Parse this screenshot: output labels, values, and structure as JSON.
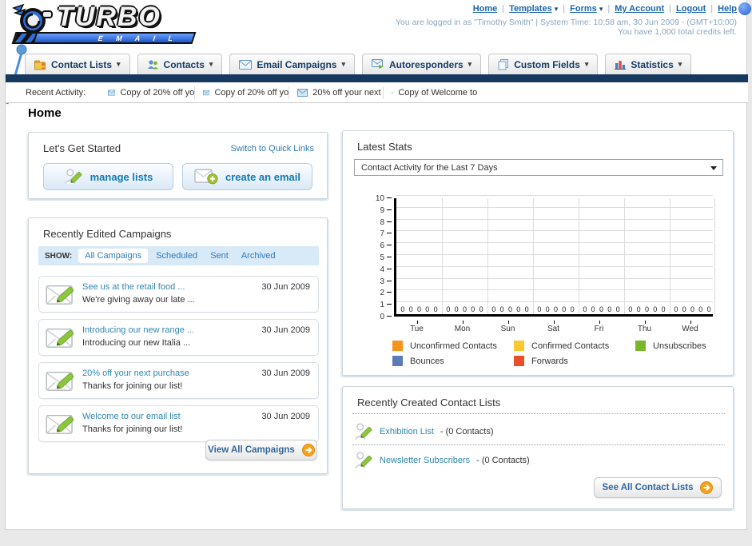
{
  "icons": {
    "dropdown_arrow": "▾"
  },
  "header": {
    "logo_title": "TURBO",
    "logo_subtitle": "E M A I L",
    "separator": "|",
    "nav_links": [
      {
        "label": "Home",
        "dropdown": false
      },
      {
        "label": "Templates",
        "dropdown": true
      },
      {
        "label": "Forms",
        "dropdown": true
      },
      {
        "label": "My Account",
        "dropdown": false
      },
      {
        "label": "Logout",
        "dropdown": false
      },
      {
        "label": "Help",
        "dropdown": false
      }
    ],
    "login_info": "You are logged in as \"Timothy Smith\" | System Time: 10:58 am, 30 Jun 2009 - (GMT+10:00)",
    "credits_info": "You have 1,000 total credits left."
  },
  "nav_tabs": [
    {
      "label": "Contact Lists",
      "icon": "contact-lists-icon"
    },
    {
      "label": "Contacts",
      "icon": "contacts-icon"
    },
    {
      "label": "Email Campaigns",
      "icon": "email-campaigns-icon"
    },
    {
      "label": "Autoresponders",
      "icon": "autoresponders-icon"
    },
    {
      "label": "Custom Fields",
      "icon": "custom-fields-icon"
    },
    {
      "label": "Statistics",
      "icon": "statistics-icon"
    }
  ],
  "recent_activity": {
    "label": "Recent Activity:",
    "items": [
      "Copy of 20% off yo",
      "Copy of 20% off yo",
      "20% off your next",
      "Copy of Welcome to"
    ]
  },
  "home": {
    "title": "Home"
  },
  "get_started": {
    "title": "Let's Get Started",
    "switch_link": "Switch to Quick Links",
    "manage_lists_label": "manage lists",
    "create_email_label": "create an email"
  },
  "campaigns": {
    "title": "Recently Edited Campaigns",
    "show_label": "SHOW:",
    "filters": [
      "All Campaigns",
      "Scheduled",
      "Sent",
      "Archived"
    ],
    "active_filter": "All Campaigns",
    "items": [
      {
        "title": "See us at the retail food ...",
        "subtitle": "We're giving away our late ...",
        "date": "30 Jun 2009"
      },
      {
        "title": "Introducing our new range ...",
        "subtitle": "Introducing our new Italia ...",
        "date": "30 Jun 2009"
      },
      {
        "title": "20% off your next purchase",
        "subtitle": "Thanks for joining our list!",
        "date": "30 Jun 2009"
      },
      {
        "title": "Welcome to our email list",
        "subtitle": "Thanks for joining our list!",
        "date": "30 Jun 2009"
      }
    ],
    "view_all_label": "View All Campaigns"
  },
  "stats": {
    "title": "Latest Stats",
    "dropdown_value": "Contact Activity for the Last 7 Days"
  },
  "chart_data": {
    "type": "bar",
    "title": "Contact Activity for the Last 7 Days",
    "categories": [
      "Tue",
      "Mon",
      "Sun",
      "Sat",
      "Fri",
      "Thu",
      "Wed"
    ],
    "series": [
      {
        "name": "Unconfirmed Contacts",
        "color": "#F7941E",
        "values": [
          0,
          0,
          0,
          0,
          0,
          0,
          0
        ]
      },
      {
        "name": "Confirmed Contacts",
        "color": "#FDC72F",
        "values": [
          0,
          0,
          0,
          0,
          0,
          0,
          0
        ]
      },
      {
        "name": "Unsubscribes",
        "color": "#7AB629",
        "values": [
          0,
          0,
          0,
          0,
          0,
          0,
          0
        ]
      },
      {
        "name": "Bounces",
        "color": "#5C7CB7",
        "values": [
          0,
          0,
          0,
          0,
          0,
          0,
          0
        ]
      },
      {
        "name": "Forwards",
        "color": "#E8502A",
        "values": [
          0,
          0,
          0,
          0,
          0,
          0,
          0
        ]
      }
    ],
    "xlabel": "",
    "ylabel": "",
    "ylim": [
      0,
      10
    ],
    "ytick_step": 1,
    "grid": true,
    "legend_position": "bottom"
  },
  "contact_lists": {
    "title": "Recently Created Contact Lists",
    "items": [
      {
        "name": "Exhibition List",
        "suffix": " - (0 Contacts)"
      },
      {
        "name": "Newsletter Subscribers",
        "suffix": " - (0 Contacts)"
      }
    ],
    "see_all_label": "See All Contact Lists"
  }
}
